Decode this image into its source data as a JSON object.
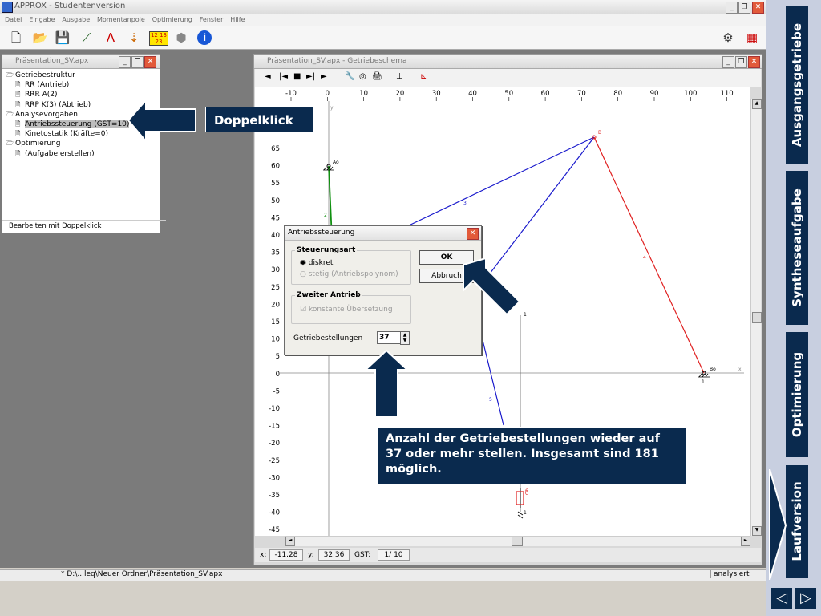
{
  "app": {
    "title": "APPROX - Studentenversion",
    "menu": [
      "Datei",
      "Eingabe",
      "Ausgabe",
      "Momentanpole",
      "Optimierung",
      "Fenster",
      "Hilfe"
    ]
  },
  "tree_window": {
    "title": "Präsentation_SV.apx",
    "items": [
      {
        "label": "Getriebestruktur",
        "level": 0,
        "icon": "folder-icon"
      },
      {
        "label": "RR (Antrieb)",
        "level": 1,
        "icon": "document-icon"
      },
      {
        "label": "RRR A(2)",
        "level": 1,
        "icon": "document-icon"
      },
      {
        "label": "RRP K(3) (Abtrieb)",
        "level": 1,
        "icon": "document-icon"
      },
      {
        "label": "Analysevorgaben",
        "level": 0,
        "icon": "folder-icon"
      },
      {
        "label": "Antriebssteuerung (GST=10)",
        "level": 1,
        "icon": "document-icon",
        "selected": true
      },
      {
        "label": "Kinetostatik (Kräfte=0)",
        "level": 1,
        "icon": "document-icon"
      },
      {
        "label": "Optimierung",
        "level": 0,
        "icon": "folder-icon"
      },
      {
        "label": "(Aufgabe erstellen)",
        "level": 1,
        "icon": "document-icon"
      }
    ],
    "status": "Bearbeiten mit Doppelklick"
  },
  "schema_window": {
    "title": "Präsentation_SV.apx - Getriebeschema",
    "toolbar": [
      "◄",
      "|◄",
      "■",
      "►|",
      "►",
      "🔧",
      "◎",
      "🖨",
      "⊥",
      "⊾"
    ],
    "x_ticks": [
      "-10",
      "0",
      "10",
      "20",
      "30",
      "40",
      "50",
      "60",
      "70",
      "80",
      "90",
      "100",
      "110"
    ],
    "y_ticks": [
      "65",
      "60",
      "55",
      "50",
      "45",
      "40",
      "35",
      "30",
      "25",
      "20",
      "15",
      "10",
      "5",
      "0",
      "-5",
      "-10",
      "-15",
      "-20",
      "-25",
      "-30",
      "-35",
      "-40",
      "-45"
    ],
    "axis_labels": {
      "x": "x",
      "y": "y"
    },
    "points": {
      "ao": "Ao",
      "b": "B",
      "bo": "Bo",
      "c": "C"
    },
    "links": {
      "l1a": "1",
      "l1b": "1",
      "l1c": "1",
      "l2": "2",
      "l3": "3",
      "l4": "4",
      "l5": "5",
      "l6": "6"
    },
    "coords": {
      "x_label": "x:",
      "x_value": "-11.28",
      "y_label": "y:",
      "y_value": "32.36",
      "gst_label": "GST:",
      "gst_value": "1/ 10"
    }
  },
  "dialog": {
    "title": "Antriebssteuerung",
    "group1": "Steuerungsart",
    "radio1": "diskret",
    "radio2": "stetig (Antriebspolynom)",
    "group2": "Zweiter Antrieb",
    "checkbox": "konstante Übersetzung",
    "field_label": "Getriebestellungen",
    "field_value": "37",
    "ok": "OK",
    "cancel": "Abbruch"
  },
  "statusbar": {
    "path": "* D:\\...leq\\Neuer Ordner\\Präsentation_SV.apx",
    "state": "analysiert"
  },
  "overlay": {
    "callout_doubleclick": "Doppelklick",
    "callout_info": "Anzahl der Getriebestellungen wieder auf 37 oder mehr stellen. Insgesamt sind 181 möglich."
  },
  "nav": {
    "tabs": [
      "Ausgangsgetriebe",
      "Syntheseaufgabe",
      "Optimierung",
      "Laufversion"
    ],
    "prev": "◁",
    "next": "▷"
  },
  "colors": {
    "navy": "#0a2a4e",
    "link_blue": "#1a1acc",
    "link_red": "#e02020",
    "link_green": "#109010"
  }
}
